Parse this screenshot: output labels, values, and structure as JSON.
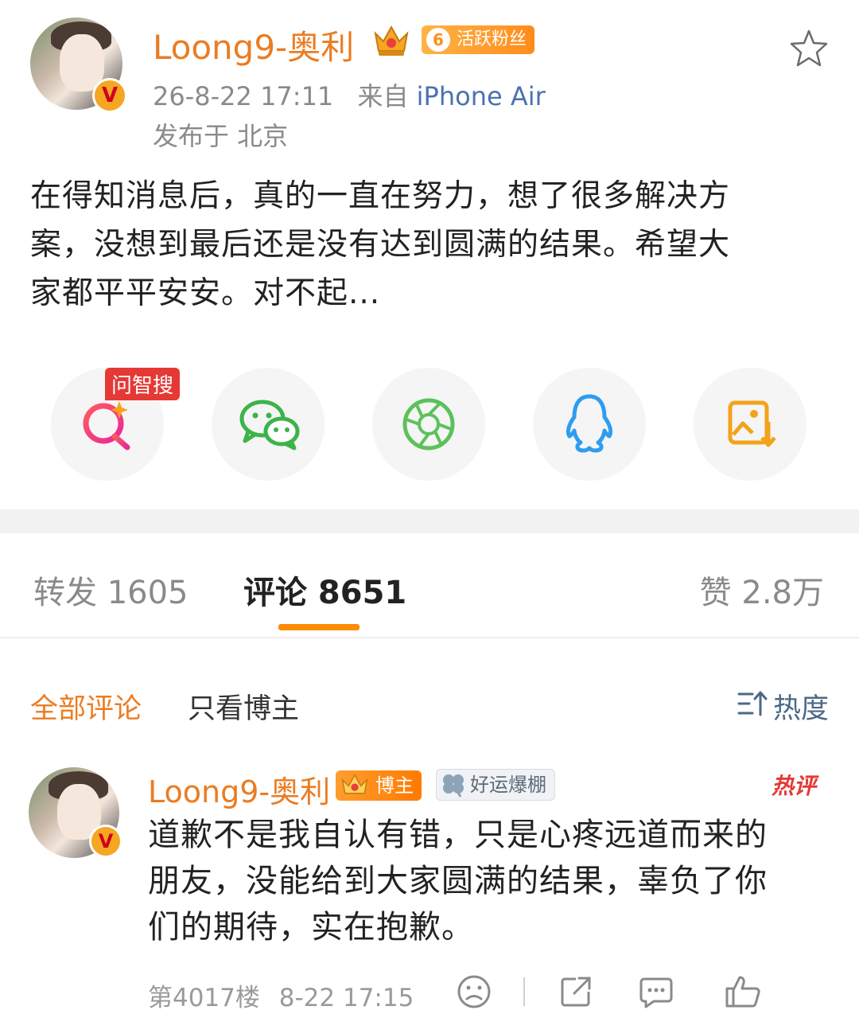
{
  "post": {
    "author": "Loong9-奥利",
    "verified_mark": "V",
    "fan_badge": {
      "level": "6",
      "label": "活跃粉丝"
    },
    "timestamp": "26-8-22 17:11",
    "source_prefix": "来自",
    "device": "iPhone Air",
    "location": "发布于 北京",
    "text_lines": [
      "在得知消息后，真的一直在努力，想了很多解决方",
      "案，没想到最后还是没有达到圆满的结果。希望大",
      "家都平平安安。对不起..."
    ],
    "favorite_icon": "star-outline-icon"
  },
  "share": {
    "search_tag": "问智搜",
    "targets": [
      {
        "name": "search-ai",
        "icon": "magnifier-sparkle-icon",
        "color": "#f0484b"
      },
      {
        "name": "wechat",
        "icon": "wechat-icon",
        "color": "#3cb34a"
      },
      {
        "name": "moments",
        "icon": "aperture-icon",
        "color": "#5cc15b"
      },
      {
        "name": "qq",
        "icon": "penguin-icon",
        "color": "#2e9df0"
      },
      {
        "name": "save-image",
        "icon": "image-download-icon",
        "color": "#f3a21a"
      }
    ]
  },
  "stats_tabs": {
    "repost": "转发 1605",
    "comment": "评论 8651",
    "like": "赞 2.8万",
    "active": "comment"
  },
  "comment_filter": {
    "all": "全部评论",
    "author_only": "只看博主",
    "sort": "热度",
    "sort_icon": "sort-icon"
  },
  "comment": {
    "author": "Loong9-奥利",
    "host_badge": "博主",
    "luck_badge": "好运爆棚",
    "hot_label": "热评",
    "text_lines": [
      "道歉不是我自认有错，只是心疼远道而来的",
      "朋友，没能给到大家圆满的结果，辜负了你",
      "们的期待，实在抱歉。"
    ],
    "floor": "第4017楼",
    "time": "8-22 17:15"
  },
  "colors": {
    "accent_orange": "#eb7c22",
    "tab_underline": "#ff8c00",
    "device_blue": "#4a72b2",
    "hot_red": "#e53935"
  }
}
